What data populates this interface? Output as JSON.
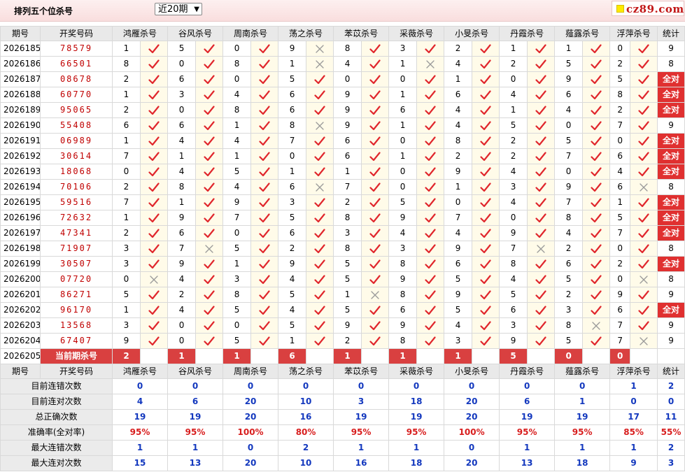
{
  "header": {
    "title": "排列五个位杀号",
    "period_select": "近20期",
    "logo_text": "cz89.com"
  },
  "columns": [
    "期号",
    "开奖号码",
    "鸿雁杀号",
    "谷风杀号",
    "周南杀号",
    "荡之杀号",
    "苯苡杀号",
    "采薇杀号",
    "小旻杀号",
    "丹霞杀号",
    "薤露杀号",
    "浮萍杀号",
    "统计"
  ],
  "rows": [
    {
      "issue": "2026185",
      "number": "78579",
      "kills": [
        [
          "1",
          true
        ],
        [
          "5",
          true
        ],
        [
          "0",
          true
        ],
        [
          "9",
          false
        ],
        [
          "8",
          true
        ],
        [
          "3",
          true
        ],
        [
          "2",
          true
        ],
        [
          "1",
          true
        ],
        [
          "1",
          true
        ],
        [
          "0",
          true
        ]
      ],
      "stat": "9",
      "all": false
    },
    {
      "issue": "2026186",
      "number": "66501",
      "kills": [
        [
          "8",
          true
        ],
        [
          "0",
          true
        ],
        [
          "8",
          true
        ],
        [
          "1",
          false
        ],
        [
          "4",
          true
        ],
        [
          "1",
          false
        ],
        [
          "4",
          true
        ],
        [
          "2",
          true
        ],
        [
          "5",
          true
        ],
        [
          "2",
          true
        ]
      ],
      "stat": "8",
      "all": false
    },
    {
      "issue": "2026187",
      "number": "08678",
      "kills": [
        [
          "2",
          true
        ],
        [
          "6",
          true
        ],
        [
          "0",
          true
        ],
        [
          "5",
          true
        ],
        [
          "0",
          true
        ],
        [
          "0",
          true
        ],
        [
          "1",
          true
        ],
        [
          "0",
          true
        ],
        [
          "9",
          true
        ],
        [
          "5",
          true
        ]
      ],
      "stat": "全对",
      "all": true
    },
    {
      "issue": "2026188",
      "number": "60770",
      "kills": [
        [
          "1",
          true
        ],
        [
          "3",
          true
        ],
        [
          "4",
          true
        ],
        [
          "6",
          true
        ],
        [
          "9",
          true
        ],
        [
          "1",
          true
        ],
        [
          "6",
          true
        ],
        [
          "4",
          true
        ],
        [
          "6",
          true
        ],
        [
          "8",
          true
        ]
      ],
      "stat": "全对",
      "all": true
    },
    {
      "issue": "2026189",
      "number": "95065",
      "kills": [
        [
          "2",
          true
        ],
        [
          "0",
          true
        ],
        [
          "8",
          true
        ],
        [
          "6",
          true
        ],
        [
          "9",
          true
        ],
        [
          "6",
          true
        ],
        [
          "4",
          true
        ],
        [
          "1",
          true
        ],
        [
          "4",
          true
        ],
        [
          "2",
          true
        ]
      ],
      "stat": "全对",
      "all": true
    },
    {
      "issue": "2026190",
      "number": "55408",
      "kills": [
        [
          "6",
          true
        ],
        [
          "6",
          true
        ],
        [
          "1",
          true
        ],
        [
          "8",
          false
        ],
        [
          "9",
          true
        ],
        [
          "1",
          true
        ],
        [
          "4",
          true
        ],
        [
          "5",
          true
        ],
        [
          "0",
          true
        ],
        [
          "7",
          true
        ]
      ],
      "stat": "9",
      "all": false
    },
    {
      "issue": "2026191",
      "number": "06989",
      "kills": [
        [
          "1",
          true
        ],
        [
          "4",
          true
        ],
        [
          "4",
          true
        ],
        [
          "7",
          true
        ],
        [
          "6",
          true
        ],
        [
          "0",
          true
        ],
        [
          "8",
          true
        ],
        [
          "2",
          true
        ],
        [
          "5",
          true
        ],
        [
          "0",
          true
        ]
      ],
      "stat": "全对",
      "all": true
    },
    {
      "issue": "2026192",
      "number": "30614",
      "kills": [
        [
          "7",
          true
        ],
        [
          "1",
          true
        ],
        [
          "1",
          true
        ],
        [
          "0",
          true
        ],
        [
          "6",
          true
        ],
        [
          "1",
          true
        ],
        [
          "2",
          true
        ],
        [
          "2",
          true
        ],
        [
          "7",
          true
        ],
        [
          "6",
          true
        ]
      ],
      "stat": "全对",
      "all": true
    },
    {
      "issue": "2026193",
      "number": "18068",
      "kills": [
        [
          "0",
          true
        ],
        [
          "4",
          true
        ],
        [
          "5",
          true
        ],
        [
          "1",
          true
        ],
        [
          "1",
          true
        ],
        [
          "0",
          true
        ],
        [
          "9",
          true
        ],
        [
          "4",
          true
        ],
        [
          "0",
          true
        ],
        [
          "4",
          true
        ]
      ],
      "stat": "全对",
      "all": true
    },
    {
      "issue": "2026194",
      "number": "70106",
      "kills": [
        [
          "2",
          true
        ],
        [
          "8",
          true
        ],
        [
          "4",
          true
        ],
        [
          "6",
          false
        ],
        [
          "7",
          true
        ],
        [
          "0",
          true
        ],
        [
          "1",
          true
        ],
        [
          "3",
          true
        ],
        [
          "9",
          true
        ],
        [
          "6",
          false
        ]
      ],
      "stat": "8",
      "all": false
    },
    {
      "issue": "2026195",
      "number": "59516",
      "kills": [
        [
          "7",
          true
        ],
        [
          "1",
          true
        ],
        [
          "9",
          true
        ],
        [
          "3",
          true
        ],
        [
          "2",
          true
        ],
        [
          "5",
          true
        ],
        [
          "0",
          true
        ],
        [
          "4",
          true
        ],
        [
          "7",
          true
        ],
        [
          "1",
          true
        ]
      ],
      "stat": "全对",
      "all": true
    },
    {
      "issue": "2026196",
      "number": "72632",
      "kills": [
        [
          "1",
          true
        ],
        [
          "9",
          true
        ],
        [
          "7",
          true
        ],
        [
          "5",
          true
        ],
        [
          "8",
          true
        ],
        [
          "9",
          true
        ],
        [
          "7",
          true
        ],
        [
          "0",
          true
        ],
        [
          "8",
          true
        ],
        [
          "5",
          true
        ]
      ],
      "stat": "全对",
      "all": true
    },
    {
      "issue": "2026197",
      "number": "47341",
      "kills": [
        [
          "2",
          true
        ],
        [
          "6",
          true
        ],
        [
          "0",
          true
        ],
        [
          "6",
          true
        ],
        [
          "3",
          true
        ],
        [
          "4",
          true
        ],
        [
          "4",
          true
        ],
        [
          "9",
          true
        ],
        [
          "4",
          true
        ],
        [
          "7",
          true
        ]
      ],
      "stat": "全对",
      "all": true
    },
    {
      "issue": "2026198",
      "number": "71907",
      "kills": [
        [
          "3",
          true
        ],
        [
          "7",
          false
        ],
        [
          "5",
          true
        ],
        [
          "2",
          true
        ],
        [
          "8",
          true
        ],
        [
          "3",
          true
        ],
        [
          "9",
          true
        ],
        [
          "7",
          false
        ],
        [
          "2",
          true
        ],
        [
          "0",
          true
        ]
      ],
      "stat": "8",
      "all": false
    },
    {
      "issue": "2026199",
      "number": "30507",
      "kills": [
        [
          "3",
          true
        ],
        [
          "9",
          true
        ],
        [
          "1",
          true
        ],
        [
          "9",
          true
        ],
        [
          "5",
          true
        ],
        [
          "8",
          true
        ],
        [
          "6",
          true
        ],
        [
          "8",
          true
        ],
        [
          "6",
          true
        ],
        [
          "2",
          true
        ]
      ],
      "stat": "全对",
      "all": true
    },
    {
      "issue": "2026200",
      "number": "07720",
      "kills": [
        [
          "0",
          false
        ],
        [
          "4",
          true
        ],
        [
          "3",
          true
        ],
        [
          "4",
          true
        ],
        [
          "5",
          true
        ],
        [
          "9",
          true
        ],
        [
          "5",
          true
        ],
        [
          "4",
          true
        ],
        [
          "5",
          true
        ],
        [
          "0",
          false
        ]
      ],
      "stat": "8",
      "all": false
    },
    {
      "issue": "2026201",
      "number": "86271",
      "kills": [
        [
          "5",
          true
        ],
        [
          "2",
          true
        ],
        [
          "8",
          true
        ],
        [
          "5",
          true
        ],
        [
          "1",
          false
        ],
        [
          "8",
          true
        ],
        [
          "9",
          true
        ],
        [
          "5",
          true
        ],
        [
          "2",
          true
        ],
        [
          "9",
          true
        ]
      ],
      "stat": "9",
      "all": false
    },
    {
      "issue": "2026202",
      "number": "96170",
      "kills": [
        [
          "1",
          true
        ],
        [
          "4",
          true
        ],
        [
          "5",
          true
        ],
        [
          "4",
          true
        ],
        [
          "5",
          true
        ],
        [
          "6",
          true
        ],
        [
          "5",
          true
        ],
        [
          "6",
          true
        ],
        [
          "3",
          true
        ],
        [
          "6",
          true
        ]
      ],
      "stat": "全对",
      "all": true
    },
    {
      "issue": "2026203",
      "number": "13568",
      "kills": [
        [
          "3",
          true
        ],
        [
          "0",
          true
        ],
        [
          "0",
          true
        ],
        [
          "5",
          true
        ],
        [
          "9",
          true
        ],
        [
          "9",
          true
        ],
        [
          "4",
          true
        ],
        [
          "3",
          true
        ],
        [
          "8",
          false
        ],
        [
          "7",
          true
        ]
      ],
      "stat": "9",
      "all": false
    },
    {
      "issue": "2026204",
      "number": "67407",
      "kills": [
        [
          "9",
          true
        ],
        [
          "0",
          true
        ],
        [
          "5",
          true
        ],
        [
          "1",
          true
        ],
        [
          "2",
          true
        ],
        [
          "8",
          true
        ],
        [
          "3",
          true
        ],
        [
          "9",
          true
        ],
        [
          "5",
          true
        ],
        [
          "7",
          false
        ]
      ],
      "stat": "9",
      "all": false
    }
  ],
  "current": {
    "issue": "2026205",
    "label": "当前期杀号",
    "values": [
      "2",
      "1",
      "1",
      "6",
      "1",
      "1",
      "1",
      "5",
      "0",
      "0"
    ]
  },
  "stats": [
    {
      "label": "目前连错次数",
      "values": [
        "0",
        "0",
        "0",
        "0",
        "0",
        "0",
        "0",
        "0",
        "0",
        "1",
        "2"
      ],
      "pct": false
    },
    {
      "label": "目前连对次数",
      "values": [
        "4",
        "6",
        "20",
        "10",
        "3",
        "18",
        "20",
        "6",
        "1",
        "0",
        "0"
      ],
      "pct": false
    },
    {
      "label": "总正确次数",
      "values": [
        "19",
        "19",
        "20",
        "16",
        "19",
        "19",
        "20",
        "19",
        "19",
        "17",
        "11"
      ],
      "pct": false
    },
    {
      "label": "准确率(全对率)",
      "values": [
        "95%",
        "95%",
        "100%",
        "80%",
        "95%",
        "95%",
        "100%",
        "95%",
        "95%",
        "85%",
        "55%"
      ],
      "pct": true
    },
    {
      "label": "最大连错次数",
      "values": [
        "1",
        "1",
        "0",
        "2",
        "1",
        "1",
        "0",
        "1",
        "1",
        "1",
        "2"
      ],
      "pct": false
    },
    {
      "label": "最大连对次数",
      "values": [
        "15",
        "13",
        "20",
        "10",
        "16",
        "18",
        "20",
        "13",
        "18",
        "9",
        "3"
      ],
      "pct": false
    }
  ],
  "colors": {
    "check": "#e0262c",
    "cross": "#9a9a9a",
    "number": "#c00000",
    "stat_value": "#1338be",
    "all_correct_bg": "#e03030"
  },
  "icons": {
    "correct": "check-icon",
    "wrong": "cross-icon"
  }
}
